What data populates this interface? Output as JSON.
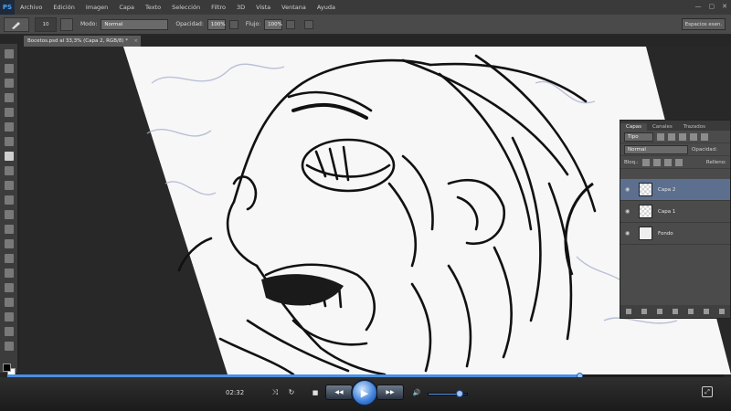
{
  "app": {
    "logo": "PS",
    "menu": [
      "Archivo",
      "Edición",
      "Imagen",
      "Capa",
      "Texto",
      "Selección",
      "Filtro",
      "3D",
      "Vista",
      "Ventana",
      "Ayuda"
    ],
    "window_controls": [
      "—",
      "▢",
      "✕"
    ]
  },
  "options_bar": {
    "brush_size": "10",
    "mode_label": "Modo:",
    "mode_value": "Normal",
    "opacity_label": "Opacidad:",
    "opacity_value": "100%",
    "flow_label": "Flujo:",
    "flow_value": "100%",
    "workspace": "Espacios esen."
  },
  "document_tab": {
    "title": "Bocetos.psd al 33,3% (Capa 2, RGB/8) *",
    "close": "×"
  },
  "layers_panel": {
    "tabs": [
      "Capas",
      "Canales",
      "Trazados"
    ],
    "filter_value": "Tipo",
    "blend_mode": "Normal",
    "opacity_label": "Opacidad:",
    "lock_label": "Bloq.:",
    "fill_label": "Relleno:",
    "layers": [
      {
        "name": "Capa 2",
        "active": true,
        "checker": true
      },
      {
        "name": "Capa 1",
        "active": false,
        "checker": true
      },
      {
        "name": "Fondo",
        "active": false,
        "checker": false
      }
    ]
  },
  "player": {
    "time": "02:32",
    "progress": 0.8,
    "volume": 0.8,
    "buttons": {
      "shuffle": "⤨",
      "repeat": "↻",
      "stop": "■",
      "prev": "◀◀",
      "play": "▶",
      "next": "▶▶",
      "volume": "🔊",
      "fullscreen": "⤢"
    }
  }
}
